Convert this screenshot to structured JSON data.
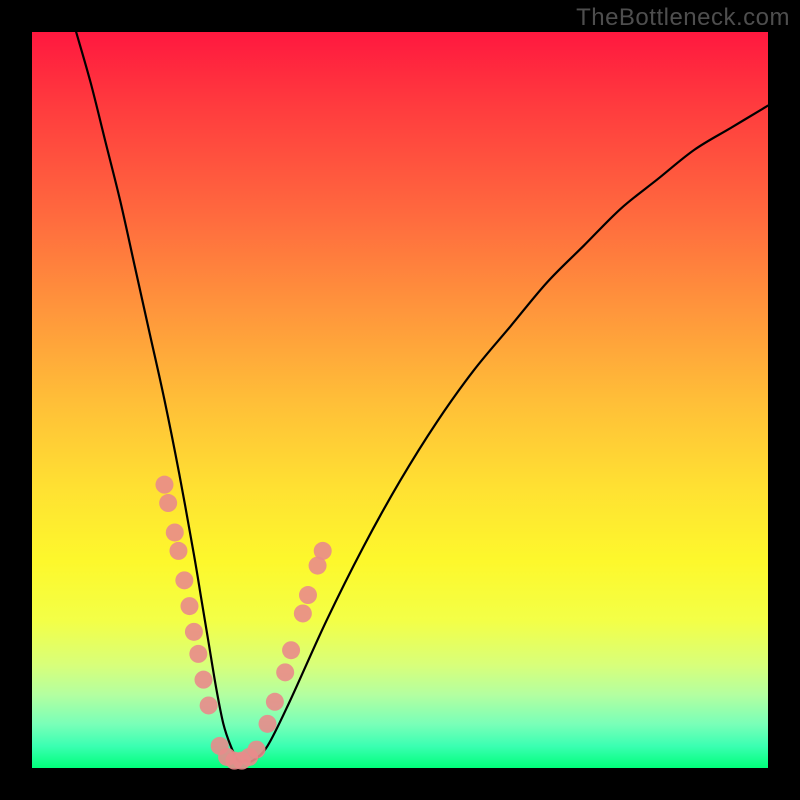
{
  "watermark": "TheBottleneck.com",
  "chart_data": {
    "type": "line",
    "title": "",
    "xlabel": "",
    "ylabel": "",
    "xlim": [
      0,
      100
    ],
    "ylim": [
      0,
      100
    ],
    "grid": false,
    "legend": false,
    "series": [
      {
        "name": "bottleneck-curve",
        "x": [
          6,
          8,
          10,
          12,
          14,
          16,
          18,
          20,
          22,
          23,
          24,
          25,
          26,
          27,
          28,
          29,
          30,
          32,
          35,
          40,
          45,
          50,
          55,
          60,
          65,
          70,
          75,
          80,
          85,
          90,
          95,
          100
        ],
        "y": [
          100,
          93,
          85,
          77,
          68,
          59,
          50,
          40,
          29,
          23,
          17,
          11,
          6,
          3,
          1,
          1,
          1,
          3,
          9,
          20,
          30,
          39,
          47,
          54,
          60,
          66,
          71,
          76,
          80,
          84,
          87,
          90
        ]
      }
    ],
    "markers": [
      {
        "name": "left-cluster",
        "points": [
          {
            "x": 18.0,
            "y": 38.5
          },
          {
            "x": 18.5,
            "y": 36.0
          },
          {
            "x": 19.4,
            "y": 32.0
          },
          {
            "x": 19.9,
            "y": 29.5
          },
          {
            "x": 20.7,
            "y": 25.5
          },
          {
            "x": 21.4,
            "y": 22.0
          },
          {
            "x": 22.0,
            "y": 18.5
          },
          {
            "x": 22.6,
            "y": 15.5
          },
          {
            "x": 23.3,
            "y": 12.0
          },
          {
            "x": 24.0,
            "y": 8.5
          }
        ]
      },
      {
        "name": "valley-cluster",
        "points": [
          {
            "x": 25.5,
            "y": 3.0
          },
          {
            "x": 26.5,
            "y": 1.5
          },
          {
            "x": 27.5,
            "y": 1.0
          },
          {
            "x": 28.5,
            "y": 1.0
          },
          {
            "x": 29.5,
            "y": 1.5
          },
          {
            "x": 30.5,
            "y": 2.5
          }
        ]
      },
      {
        "name": "right-cluster",
        "points": [
          {
            "x": 32.0,
            "y": 6.0
          },
          {
            "x": 33.0,
            "y": 9.0
          },
          {
            "x": 34.4,
            "y": 13.0
          },
          {
            "x": 35.2,
            "y": 16.0
          },
          {
            "x": 36.8,
            "y": 21.0
          },
          {
            "x": 37.5,
            "y": 23.5
          },
          {
            "x": 38.8,
            "y": 27.5
          },
          {
            "x": 39.5,
            "y": 29.5
          }
        ]
      }
    ],
    "marker_color": "#e98b8b",
    "marker_radius_px": 9
  }
}
